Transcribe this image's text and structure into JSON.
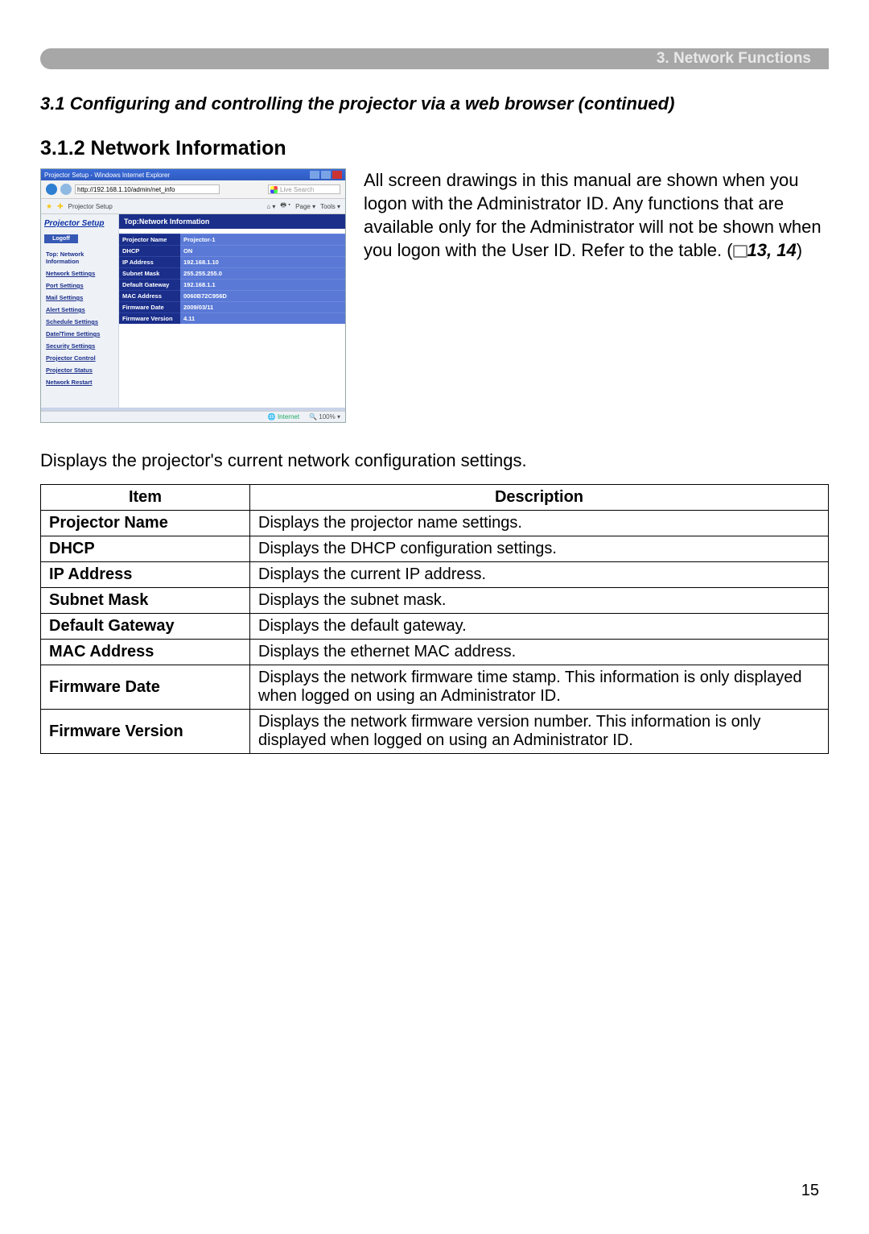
{
  "header": {
    "chapter": "3. Network Functions"
  },
  "section_title": "3.1 Configuring and controlling the projector via a web browser (continued)",
  "subsection_title": "3.1.2 Network Information",
  "intro_paragraph_parts": {
    "p1": "All screen drawings in this manual are shown when you logon with the Administrator ID. Any functions that are available only for the Administrator will not be shown when you logon with the User ID. Refer to the table. (",
    "ref": "13, 14",
    "p2": ")"
  },
  "lead": "Displays the projector's current network configuration settings.",
  "table": {
    "headers": {
      "item": "Item",
      "desc": "Description"
    },
    "rows": [
      {
        "item": "Projector Name",
        "desc": "Displays the projector name settings."
      },
      {
        "item": "DHCP",
        "desc": "Displays the DHCP configuration settings."
      },
      {
        "item": "IP Address",
        "desc": "Displays the current IP address."
      },
      {
        "item": "Subnet Mask",
        "desc": "Displays the subnet mask."
      },
      {
        "item": "Default Gateway",
        "desc": "Displays the default gateway."
      },
      {
        "item": "MAC Address",
        "desc": "Displays the ethernet MAC address."
      },
      {
        "item": "Firmware Date",
        "desc": "Displays the network firmware time stamp. This information is only displayed when logged on using an Administrator ID."
      },
      {
        "item": "Firmware Version",
        "desc": "Displays the network firmware version number. This information is only displayed when logged on using an Administrator ID."
      }
    ]
  },
  "page_number": "15",
  "screenshot": {
    "window_title": "Projector Setup - Windows Internet Explorer",
    "address": "http://192.168.1.10/admin/net_info",
    "search_placeholder": "Live Search",
    "tab_label": "Projector Setup",
    "brand": "Projector Setup",
    "logoff": "Logoff",
    "nav": [
      "Top: Network Information",
      "Network Settings",
      "Port Settings",
      "Mail Settings",
      "Alert Settings",
      "Schedule Settings",
      "Date/Time Settings",
      "Security Settings",
      "Projector Control",
      "Projector Status",
      "Network Restart"
    ],
    "panel_title": "Top:Network Information",
    "kv": [
      {
        "k": "Projector Name",
        "v": "Projector-1"
      },
      {
        "k": "DHCP",
        "v": "ON"
      },
      {
        "k": "IP Address",
        "v": "192.168.1.10"
      },
      {
        "k": "Subnet Mask",
        "v": "255.255.255.0"
      },
      {
        "k": "Default Gateway",
        "v": "192.168.1.1"
      },
      {
        "k": "MAC Address",
        "v": "0060B72C956D"
      },
      {
        "k": "Firmware Date",
        "v": "2009/03/11"
      },
      {
        "k": "Firmware Version",
        "v": "4.11"
      }
    ],
    "status_internet": "Internet",
    "status_zoom": "100%"
  }
}
